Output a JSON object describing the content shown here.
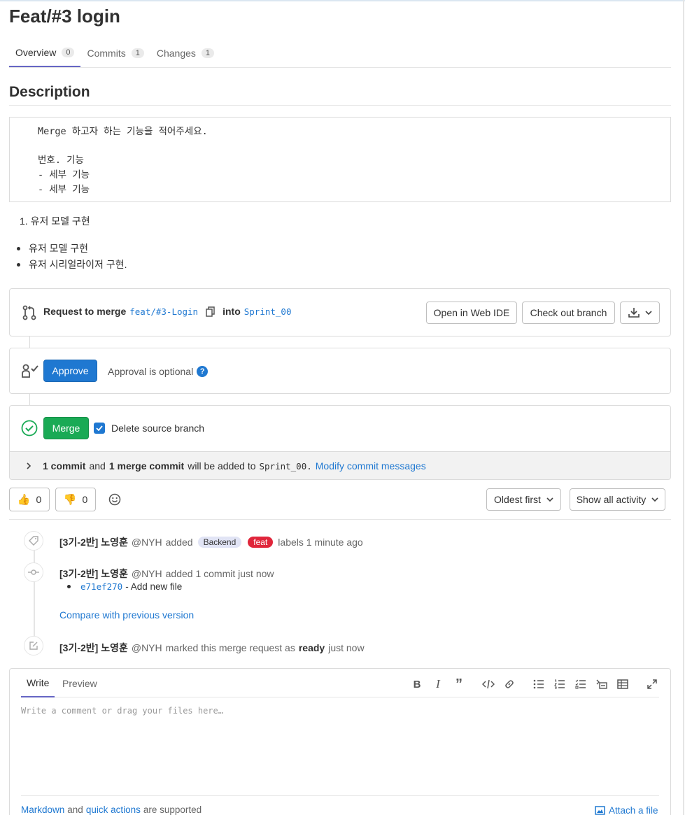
{
  "title": "Feat/#3 login",
  "tabs": [
    {
      "label": "Overview",
      "count": "0"
    },
    {
      "label": "Commits",
      "count": "1"
    },
    {
      "label": "Changes",
      "count": "1"
    }
  ],
  "description": {
    "heading": "Description",
    "template_text": "Merge 하고자 하는 기능을 적어주세요.\n\n번호. 기능\n- 세부 기능\n- 세부 기능",
    "ordered_item": "1. 유저 모델 구현",
    "bullets": [
      "유저 모델 구현",
      "유저 시리얼라이저 구현."
    ]
  },
  "merge_widget": {
    "request_label": "Request to merge",
    "source_branch": "feat/#3-Login",
    "into_label": "into",
    "target_branch": "Sprint_00",
    "web_ide_label": "Open in Web IDE",
    "checkout_label": "Check out branch"
  },
  "approval": {
    "approve_label": "Approve",
    "optional_text": "Approval is optional"
  },
  "merge": {
    "merge_label": "Merge",
    "delete_branch_label": "Delete source branch",
    "commit_count_text": "1 commit",
    "and_text": "and",
    "merge_commit_text": "1 merge commit",
    "added_text": "will be added to",
    "target": "Sprint_00.",
    "modify_link": "Modify commit messages"
  },
  "reactions": {
    "thumbs_up": "0",
    "thumbs_down": "0"
  },
  "filters": {
    "sort_label": "Oldest first",
    "activity_label": "Show all activity"
  },
  "activity": [
    {
      "author": "[3기-2반] 노영훈",
      "handle": "@NYH",
      "action": "added",
      "labels": [
        "Backend",
        "feat"
      ],
      "suffix": "labels 1 minute ago"
    },
    {
      "author": "[3기-2반] 노영훈",
      "handle": "@NYH",
      "action": "added 1 commit just now",
      "commit_sha": "e71ef270",
      "commit_msg": "- Add new file",
      "compare_link": "Compare with previous version"
    },
    {
      "author": "[3기-2반] 노영훈",
      "handle": "@NYH",
      "action": "marked this merge request as",
      "status": "ready",
      "suffix": "just now"
    }
  ],
  "comment": {
    "write_tab": "Write",
    "preview_tab": "Preview",
    "placeholder": "Write a comment or drag your files here…",
    "markdown_link": "Markdown",
    "and_text": "and",
    "quick_actions_link": "quick actions",
    "supported_text": "are supported",
    "attach_label": "Attach a file"
  },
  "colors": {
    "primary": "#1f78d1",
    "success": "#1aaa55",
    "tab_underline": "#6666c4",
    "label_backend": "#e1e4f5",
    "label_feat": "#e0263b"
  }
}
